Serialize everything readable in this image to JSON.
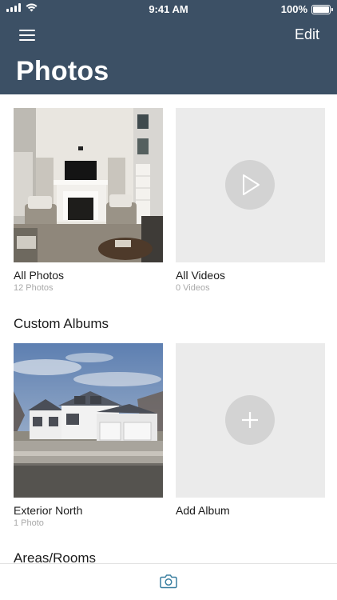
{
  "status_bar": {
    "time": "9:41 AM",
    "battery": "100%",
    "battery_level": 1.0
  },
  "nav": {
    "edit_label": "Edit",
    "title": "Photos"
  },
  "top_albums": [
    {
      "title": "All Photos",
      "count": "12 Photos"
    },
    {
      "title": "All Videos",
      "count": "0 Videos"
    }
  ],
  "custom_section": {
    "title": "Custom Albums"
  },
  "custom_albums": [
    {
      "title": "Exterior North",
      "count": "1 Photo"
    },
    {
      "title": "Add Album"
    }
  ],
  "areas_section": {
    "title": "Areas/Rooms"
  },
  "tab_bar": {
    "icon": "camera-icon"
  },
  "colors": {
    "header_bg": "#3c5065",
    "accent": "#3a7fa0",
    "placeholder_bg": "#ebebeb"
  }
}
